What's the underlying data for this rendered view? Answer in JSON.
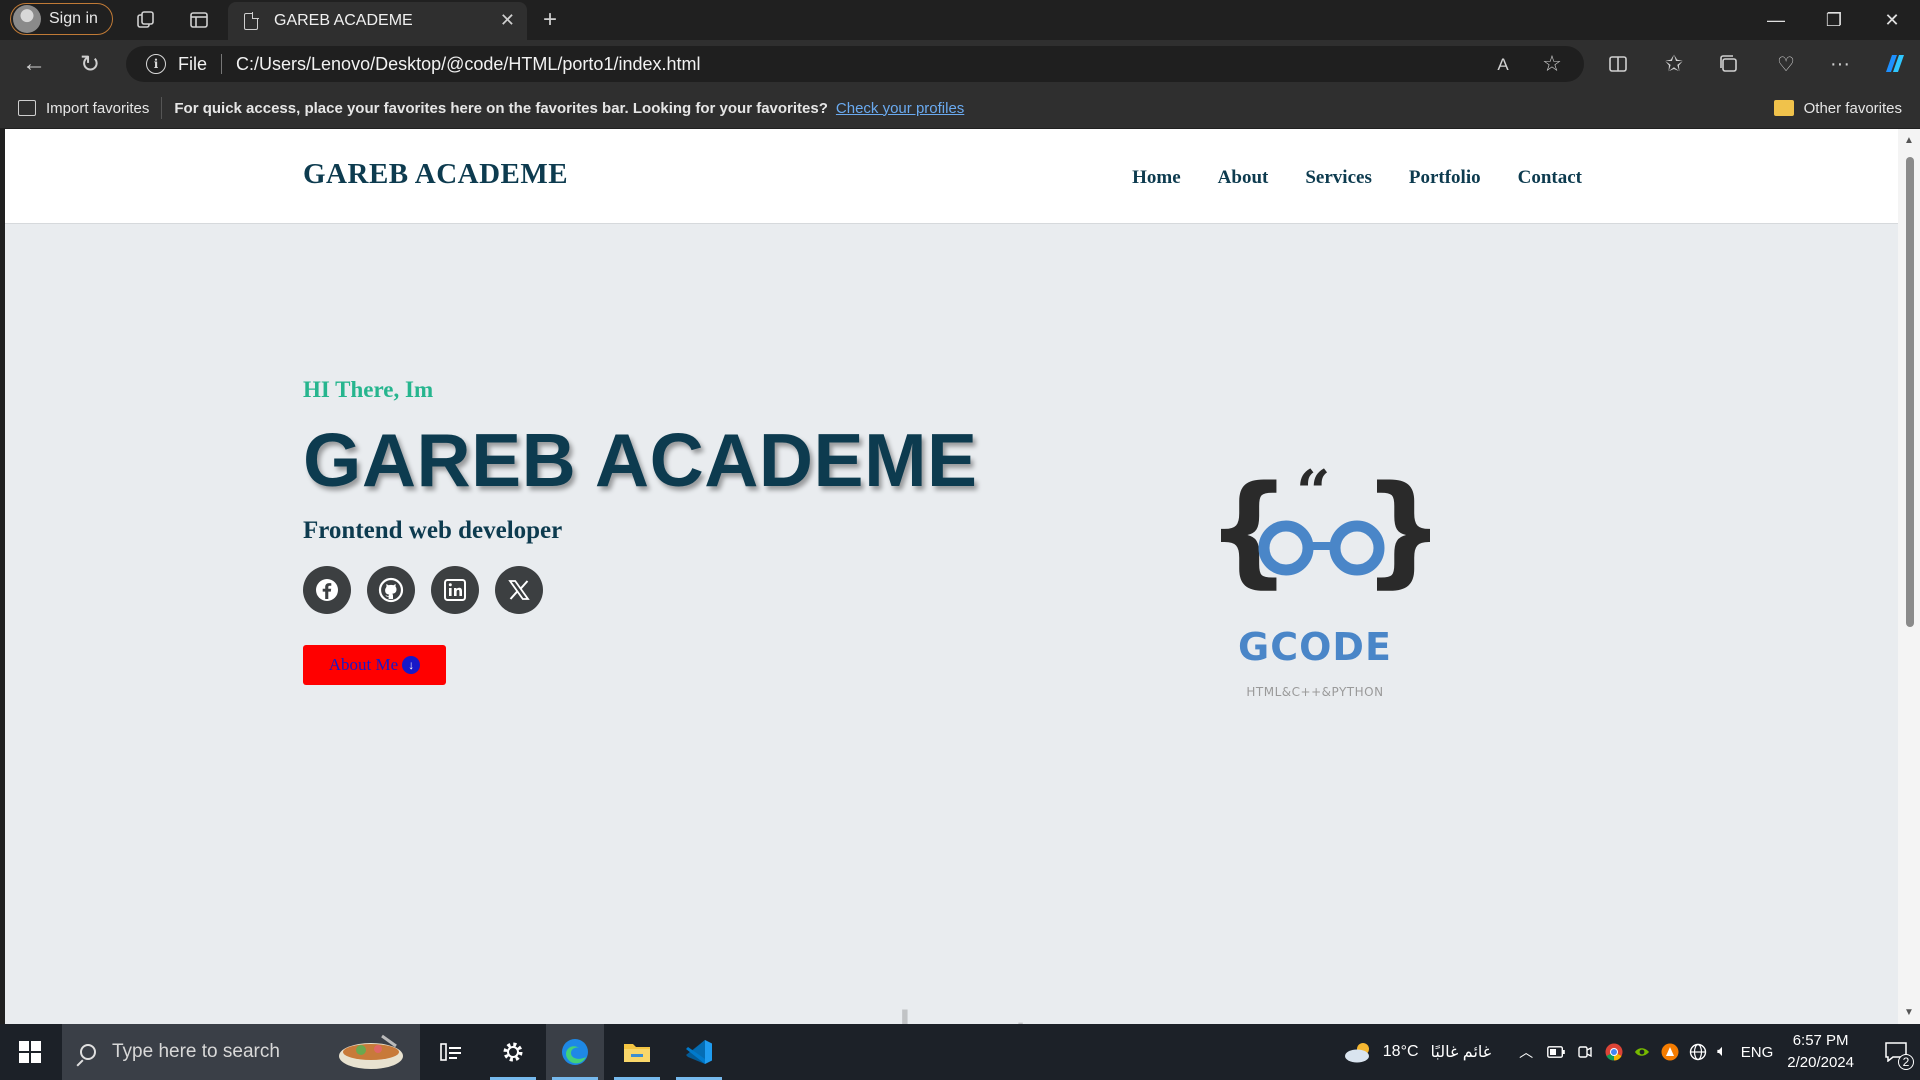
{
  "browser": {
    "signin_label": "Sign in",
    "tab_title": "GAREB ACADEME",
    "address_scheme": "File",
    "address_url": "C:/Users/Lenovo/Desktop/@code/HTML/porto1/index.html",
    "favorites_bar": {
      "import_label": "Import favorites",
      "message": "For quick access, place your favorites here on the favorites bar. Looking for your favorites?",
      "link": "Check your profiles",
      "other_label": "Other favorites"
    }
  },
  "site": {
    "logo": "GAREB ACADEME",
    "nav": [
      "Home",
      "About",
      "Services",
      "Portfolio",
      "Contact"
    ],
    "hero": {
      "greeting": "HI There, Im",
      "name": "GAREB ACADEME",
      "role": "Frontend web developer",
      "socials": [
        "facebook-icon",
        "github-icon",
        "linkedin-icon",
        "x-icon"
      ],
      "button_label": "About Me"
    },
    "brand": {
      "title": "GCODE",
      "subtitle": "HTML&C++&PYTHON",
      "colors": {
        "blue": "#4a86c8",
        "dark": "#2a2a2a"
      }
    },
    "colors": {
      "navy": "#0d3b4f",
      "teal": "#26b58e",
      "button_red": "#ff0000",
      "background": "#e9ecef"
    }
  },
  "taskbar": {
    "search_placeholder": "Type here to search",
    "weather_temp": "18°C",
    "weather_desc": "غائم غالبًا",
    "language": "ENG",
    "time": "6:57 PM",
    "date": "2/20/2024",
    "notification_count": "2"
  },
  "watermark": "خمسات"
}
